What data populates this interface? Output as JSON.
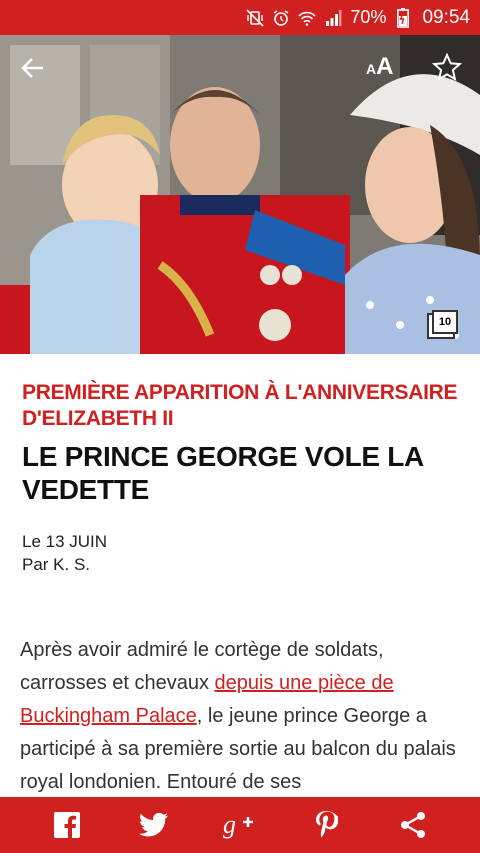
{
  "status_bar": {
    "battery": "70%",
    "time": "09:54",
    "icons": [
      "mute-vibrate-icon",
      "alarm-icon",
      "wifi-icon",
      "signal-icon",
      "battery-charging-icon"
    ]
  },
  "toolbar": {
    "font_size_label_small": "A",
    "font_size_label_large": "A"
  },
  "hero": {
    "gallery_count": "10"
  },
  "article": {
    "kicker": "PREMIÈRE APPARITION À L'ANNIVERSAIRE D'ELIZABETH II",
    "headline": "LE PRINCE GEORGE VOLE LA VEDETTE",
    "date": "Le 13 JUIN",
    "author": "Par K. S.",
    "body_before_link": "Après avoir admiré le cortège de soldats, carrosses et chevaux ",
    "body_link": "depuis une pièce de Buckingham Palace",
    "body_after_link": ", le jeune prince George a participé à sa première sortie au balcon du palais royal londonien. Entouré de ses"
  },
  "share_bar": {
    "items": [
      "facebook-icon",
      "twitter-icon",
      "google-plus-icon",
      "pinterest-icon",
      "share-icon"
    ]
  },
  "colors": {
    "brand_red": "#d0201f",
    "text_dark": "#111111",
    "text_body": "#333333"
  }
}
